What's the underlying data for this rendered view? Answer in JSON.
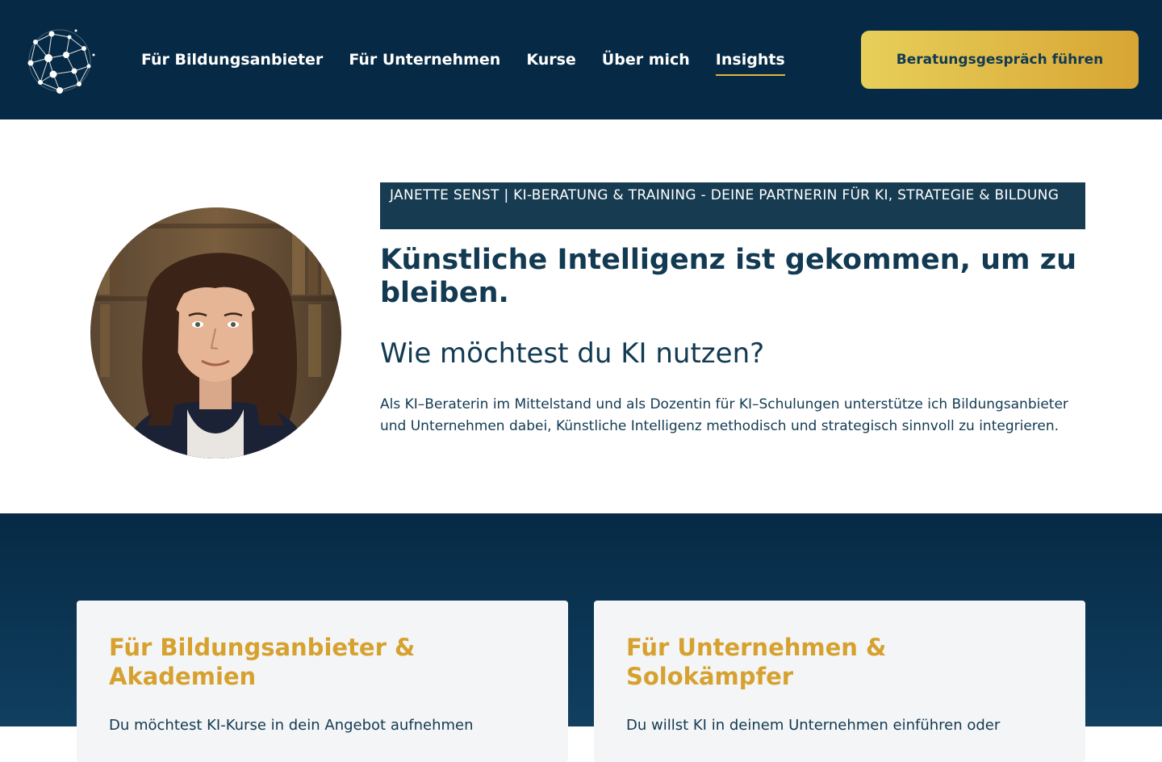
{
  "header": {
    "nav": [
      {
        "label": "Für Bildungsanbieter"
      },
      {
        "label": "Für Unternehmen"
      },
      {
        "label": "Kurse"
      },
      {
        "label": "Über mich"
      },
      {
        "label": "Insights",
        "active": true
      }
    ],
    "cta_label": "Beratungsgespräch führen"
  },
  "hero": {
    "tagline": "JANETTE SENST | KI-BERATUNG & TRAINING - DEINE PARTNERIN FÜR KI, STRATEGIE & BILDUNG",
    "title": "Künstliche Intelligenz ist gekommen, um zu bleiben.",
    "subtitle": "Wie möchtest du KI nutzen?",
    "text": "Als KI–Beraterin im Mittelstand und als Dozentin für KI–Schulungen unterstütze ich Bildungsanbieter und Unternehmen dabei, Künstliche Intelligenz methodisch und strategisch sinnvoll zu integrieren."
  },
  "services": {
    "cards": [
      {
        "title": "Für Bildungsanbieter & Akademien",
        "text": "Du möchtest KI-Kurse in dein Angebot aufnehmen"
      },
      {
        "title": "Für Unternehmen & Solokämpfer",
        "text": "Du willst KI in deinem Unternehmen einführen oder"
      }
    ]
  },
  "colors": {
    "header_bg": "#062a45",
    "accent_gold": "#d6a12e",
    "text_navy": "#123a52"
  }
}
